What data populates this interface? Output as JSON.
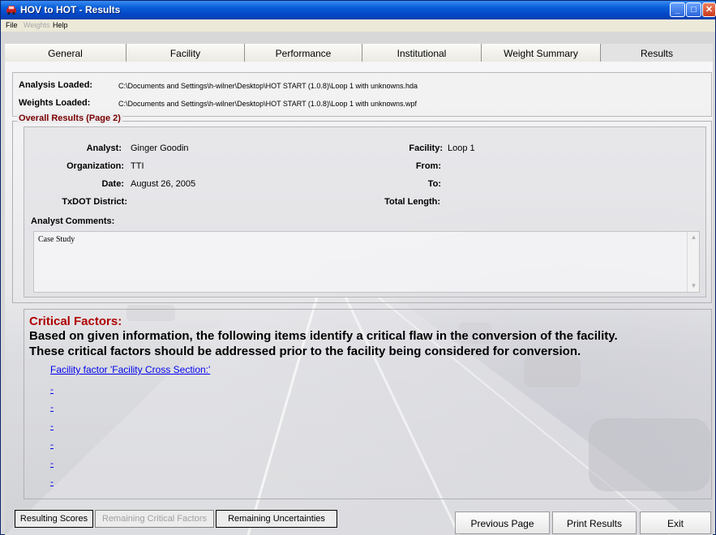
{
  "window": {
    "title": "HOV to HOT - Results",
    "controls": {
      "minimize": "_",
      "maximize": "□",
      "close": "✕"
    }
  },
  "menu": [
    "File",
    "Weights",
    "Help"
  ],
  "tabs": [
    {
      "label": "General"
    },
    {
      "label": "Facility"
    },
    {
      "label": "Performance"
    },
    {
      "label": "Institutional"
    },
    {
      "label": "Weight Summary"
    },
    {
      "label": "Results",
      "active": true
    }
  ],
  "loaded": {
    "analysis_label": "Analysis Loaded:",
    "analysis_path": "C:\\Documents and Settings\\h-wilner\\Desktop\\HOT START (1.0.8)\\Loop 1 with unknowns.hda",
    "weights_label": "Weights Loaded:",
    "weights_path": "C:\\Documents and Settings\\h-wilner\\Desktop\\HOT START (1.0.8)\\Loop 1 with unknowns.wpf"
  },
  "overall": {
    "legend": "Overall Results (Page 2)",
    "analyst_label": "Analyst:",
    "analyst_value": "Ginger Goodin",
    "organization_label": "Organization:",
    "organization_value": "TTI",
    "date_label": "Date:",
    "date_value": "August 26, 2005",
    "district_label": "TxDOT District:",
    "facility_label": "Facility:",
    "facility_value": "Loop 1",
    "from_label": "From:",
    "to_label": "To:",
    "length_label": "Total Length:",
    "comments_label": "Analyst Comments:",
    "comments_value": "Case Study",
    "scroll_up": "▲",
    "scroll_down": "▼"
  },
  "critical": {
    "title": "Critical Factors:",
    "line1": "Based on given information, the following items identify a critical flaw in the conversion of the facility.",
    "line2": "These critical factors should be addressed prior to the facility being considered for conversion.",
    "items": [
      "Facility factor 'Facility Cross Section:'",
      "-",
      "-",
      "-",
      "-",
      "-",
      "-"
    ]
  },
  "buttons": {
    "resulting_scores": "Resulting Scores",
    "remaining_critical": "Remaining Critical Factors",
    "remaining_uncertainties": "Remaining Uncertainties",
    "previous_page": "Previous Page",
    "print_results": "Print Results",
    "exit": "Exit"
  },
  "colors": {
    "titlebar": "#0a5fd8",
    "section_legend": "#7a0000",
    "critical_title": "#b00000",
    "link": "#0000ee"
  }
}
